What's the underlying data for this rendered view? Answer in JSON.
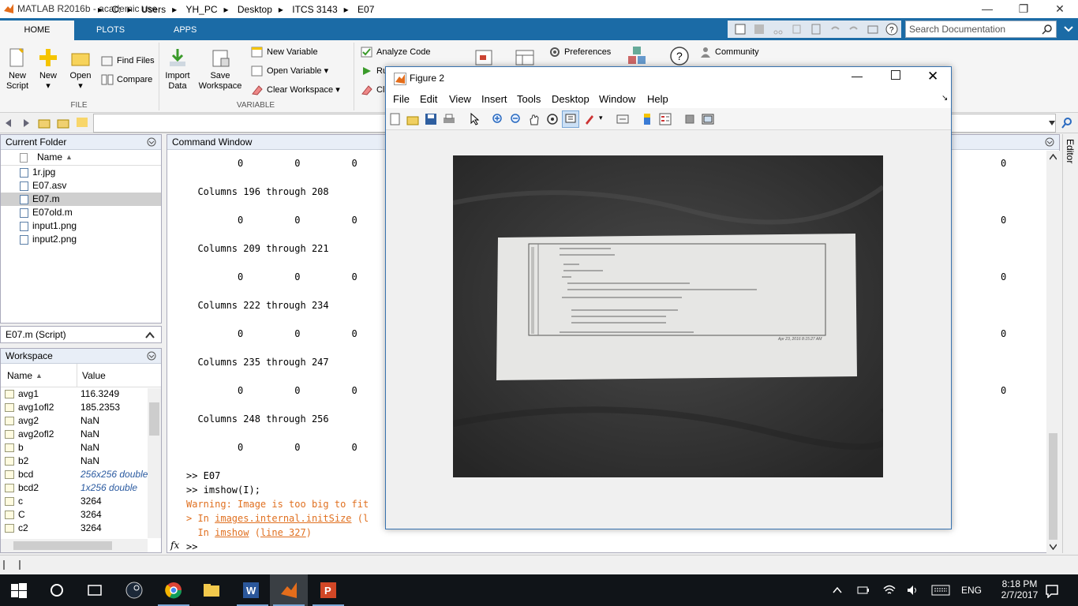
{
  "app": {
    "title": "MATLAB R2016b - academic use"
  },
  "ribbon": {
    "tabs": [
      "HOME",
      "PLOTS",
      "APPS"
    ],
    "file": {
      "new_script": "New\nScript",
      "new": "New",
      "open": "Open",
      "find_files": "Find Files",
      "compare": "Compare",
      "group": "FILE"
    },
    "variable": {
      "import": "Import\nData",
      "save": "Save\nWorkspace",
      "new_variable": "New Variable",
      "open_variable": "Open Variable",
      "clear_workspace": "Clear Workspace",
      "group": "VARIABLE"
    },
    "code": {
      "analyze": "Analyze Code",
      "run": "Ru",
      "clear": "Cl"
    },
    "env": {
      "preferences": "Preferences",
      "community": "Community"
    },
    "search_placeholder": "Search Documentation"
  },
  "path": [
    "C:",
    "Users",
    "YH_PC",
    "Desktop",
    "ITCS 3143",
    "E07"
  ],
  "current_folder": {
    "title": "Current Folder",
    "col_name": "Name",
    "files": [
      {
        "name": "1r.jpg",
        "selected": false
      },
      {
        "name": "E07.asv",
        "selected": false
      },
      {
        "name": "E07.m",
        "selected": true
      },
      {
        "name": "E07old.m",
        "selected": false
      },
      {
        "name": "input1.png",
        "selected": false
      },
      {
        "name": "input2.png",
        "selected": false
      }
    ]
  },
  "script_bar": "E07.m (Script)",
  "workspace": {
    "title": "Workspace",
    "col_name": "Name",
    "col_value": "Value",
    "vars": [
      {
        "name": "avg1",
        "value": "116.3249",
        "italic": false
      },
      {
        "name": "avg1ofl2",
        "value": "185.2353",
        "italic": false
      },
      {
        "name": "avg2",
        "value": "NaN",
        "italic": false
      },
      {
        "name": "avg2ofl2",
        "value": "NaN",
        "italic": false
      },
      {
        "name": "b",
        "value": "NaN",
        "italic": false
      },
      {
        "name": "b2",
        "value": "NaN",
        "italic": false
      },
      {
        "name": "bcd",
        "value": "256x256 double",
        "italic": true
      },
      {
        "name": "bcd2",
        "value": "1x256 double",
        "italic": true
      },
      {
        "name": "c",
        "value": "3264",
        "italic": false
      },
      {
        "name": "C",
        "value": "3264",
        "italic": false
      },
      {
        "name": "c2",
        "value": "3264",
        "italic": false
      },
      {
        "name": "C2",
        "value": "3264",
        "italic": false
      }
    ]
  },
  "command_window": {
    "title": "Command Window",
    "lines": [
      "         0         0         0",
      "",
      "  Columns 196 through 208",
      "",
      "         0         0         0",
      "",
      "  Columns 209 through 221",
      "",
      "         0         0         0",
      "",
      "  Columns 222 through 234",
      "",
      "         0         0         0",
      "",
      "  Columns 235 through 247",
      "",
      "         0         0         0",
      "",
      "  Columns 248 through 256",
      "",
      "         0         0         0",
      ""
    ],
    "right_zero": "0",
    "cmd1": ">> E07",
    "cmd2": ">> imshow(I);",
    "warning": "Warning: Image is too big to fit",
    "trace1_prefix": "> In ",
    "trace1_link": "images.internal.initSize",
    "trace1_suffix": " (l",
    "trace2_prefix": "  In ",
    "trace2_link": "imshow",
    "trace2_mid": " (",
    "trace2_line": "line 327",
    "trace2_end": ")",
    "prompt": ">>",
    "fx": "fx"
  },
  "figure": {
    "title": "Figure 2",
    "menus": [
      "File",
      "Edit",
      "View",
      "Insert",
      "Tools",
      "Desktop",
      "Window",
      "Help"
    ],
    "photo_timestamp": "Apr 23, 2016 8:15:27 AM"
  },
  "sidebar_right": "Editor",
  "taskbar": {
    "lang": "ENG",
    "time": "8:18 PM",
    "date": "2/7/2017"
  }
}
